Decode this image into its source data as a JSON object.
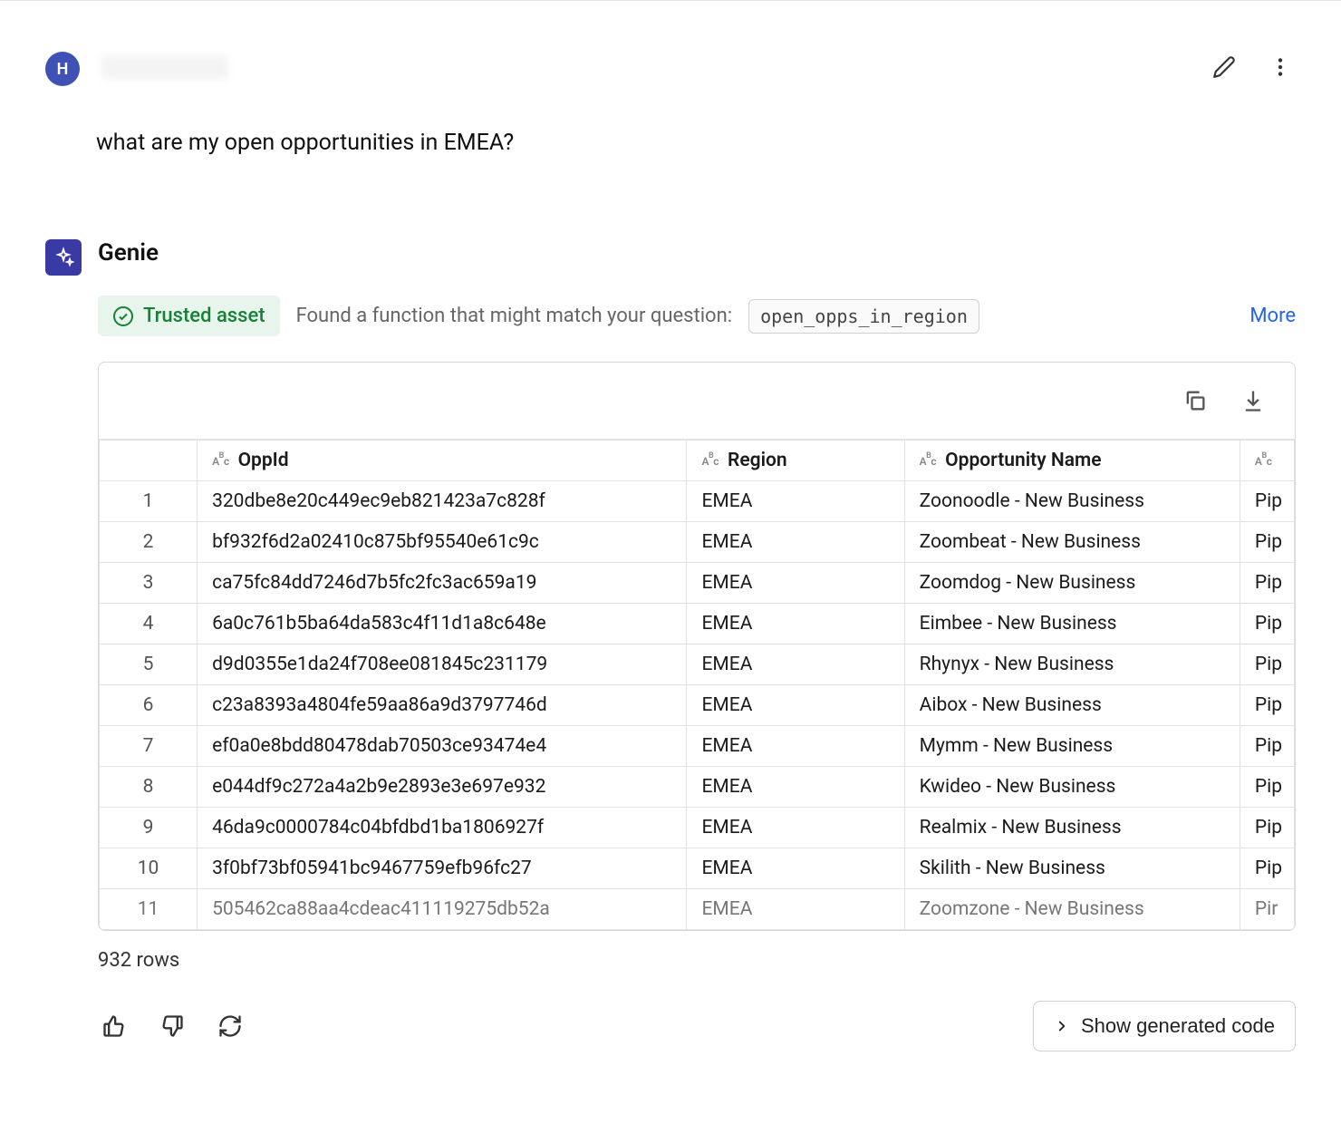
{
  "user": {
    "avatar_letter": "H",
    "question": "what are my open opportunities in EMEA?"
  },
  "assistant": {
    "name": "Genie",
    "trusted_label": "Trusted asset",
    "found_text": "Found a function that might match your question:",
    "function_name": "open_opps_in_region",
    "more_label": "More"
  },
  "table": {
    "columns": [
      "OppId",
      "Region",
      "Opportunity Name",
      ""
    ],
    "rows": [
      {
        "idx": "1",
        "oppid": "320dbe8e20c449ec9eb821423a7c828f",
        "region": "EMEA",
        "name": "Zoonoodle - New Business",
        "stage": "Pip"
      },
      {
        "idx": "2",
        "oppid": "bf932f6d2a02410c875bf95540e61c9c",
        "region": "EMEA",
        "name": "Zoombeat - New Business",
        "stage": "Pip"
      },
      {
        "idx": "3",
        "oppid": "ca75fc84dd7246d7b5fc2fc3ac659a19",
        "region": "EMEA",
        "name": "Zoomdog - New Business",
        "stage": "Pip"
      },
      {
        "idx": "4",
        "oppid": "6a0c761b5ba64da583c4f11d1a8c648e",
        "region": "EMEA",
        "name": "Eimbee - New Business",
        "stage": "Pip"
      },
      {
        "idx": "5",
        "oppid": "d9d0355e1da24f708ee081845c231179",
        "region": "EMEA",
        "name": "Rhynyx - New Business",
        "stage": "Pip"
      },
      {
        "idx": "6",
        "oppid": "c23a8393a4804fe59aa86a9d3797746d",
        "region": "EMEA",
        "name": "Aibox - New Business",
        "stage": "Pip"
      },
      {
        "idx": "7",
        "oppid": "ef0a0e8bdd80478dab70503ce93474e4",
        "region": "EMEA",
        "name": "Mymm - New Business",
        "stage": "Pip"
      },
      {
        "idx": "8",
        "oppid": "e044df9c272a4a2b9e2893e3e697e932",
        "region": "EMEA",
        "name": "Kwideo - New Business",
        "stage": "Pip"
      },
      {
        "idx": "9",
        "oppid": "46da9c0000784c04bfdbd1ba1806927f",
        "region": "EMEA",
        "name": "Realmix - New Business",
        "stage": "Pip"
      },
      {
        "idx": "10",
        "oppid": "3f0bf73bf05941bc9467759efb96fc27",
        "region": "EMEA",
        "name": "Skilith - New Business",
        "stage": "Pip"
      },
      {
        "idx": "11",
        "oppid": "505462ca88aa4cdeac411119275db52a",
        "region": "EMEA",
        "name": "Zoomzone - New Business",
        "stage": "Pir"
      }
    ],
    "row_count_text": "932 rows"
  },
  "footer": {
    "show_code_label": "Show generated code"
  }
}
